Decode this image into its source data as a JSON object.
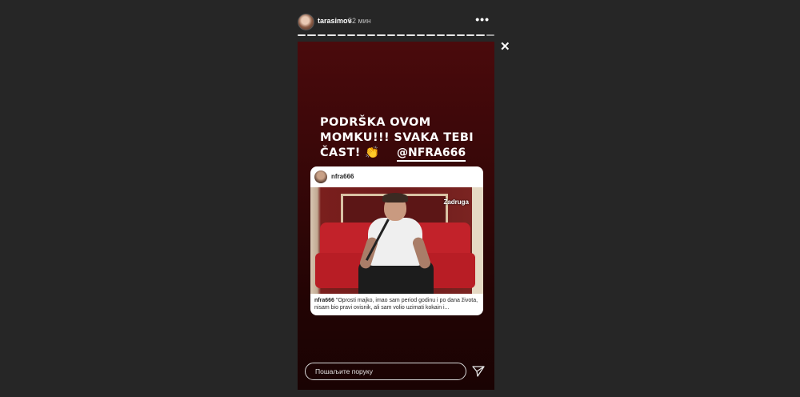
{
  "header": {
    "username": "tarasimov",
    "time": "52 мин",
    "more_icon": "•••",
    "progress_segments": 20,
    "progress_done": 19
  },
  "close_icon": "✕",
  "story": {
    "caption": "PODRŠKA OVOM MOMKU!!! SVAKA TEBI ČAST! 👏",
    "mention": "@NFRA666",
    "shared_post": {
      "username": "nfra666",
      "watermark": "Zadruga",
      "caption_user": "nfra666",
      "caption_text": " \"Oprosti majko, imao sam period godinu i po dana života, nisam bio pravi ovisnik, ali sam volio uzimati kokain i..."
    },
    "reply_placeholder": "Пошаљите поруку"
  },
  "colors": {
    "background": "#262626",
    "story_top": "#4a0a0c",
    "story_bottom": "#1a0303"
  }
}
